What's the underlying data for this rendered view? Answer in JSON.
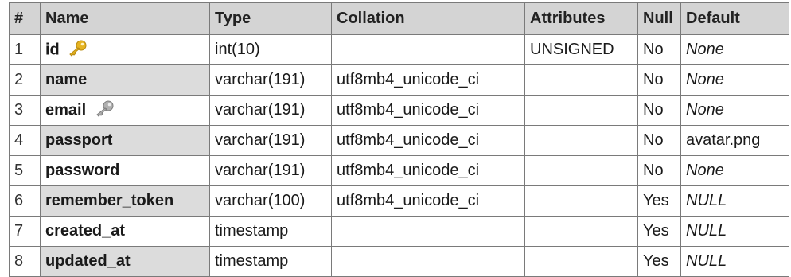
{
  "columns": [
    "#",
    "Name",
    "Type",
    "Collation",
    "Attributes",
    "Null",
    "Default"
  ],
  "rows": [
    {
      "num": "1",
      "name": "id",
      "type": "int(10)",
      "collation": "",
      "attributes": "UNSIGNED",
      "null": "No",
      "default": "None",
      "icon": "primary-key-icon",
      "icon_color": "#e6b422"
    },
    {
      "num": "2",
      "name": "name",
      "type": "varchar(191)",
      "collation": "utf8mb4_unicode_ci",
      "attributes": "",
      "null": "No",
      "default": "None"
    },
    {
      "num": "3",
      "name": "email",
      "type": "varchar(191)",
      "collation": "utf8mb4_unicode_ci",
      "attributes": "",
      "null": "No",
      "default": "None",
      "icon": "unique-key-icon",
      "icon_color": "#9a9a9a"
    },
    {
      "num": "4",
      "name": "passport",
      "type": "varchar(191)",
      "collation": "utf8mb4_unicode_ci",
      "attributes": "",
      "null": "No",
      "default": "avatar.png"
    },
    {
      "num": "5",
      "name": "password",
      "type": "varchar(191)",
      "collation": "utf8mb4_unicode_ci",
      "attributes": "",
      "null": "No",
      "default": "None"
    },
    {
      "num": "6",
      "name": "remember_token",
      "type": "varchar(100)",
      "collation": "utf8mb4_unicode_ci",
      "attributes": "",
      "null": "Yes",
      "default": "NULL"
    },
    {
      "num": "7",
      "name": "created_at",
      "type": "timestamp",
      "collation": "",
      "attributes": "",
      "null": "Yes",
      "default": "NULL"
    },
    {
      "num": "8",
      "name": "updated_at",
      "type": "timestamp",
      "collation": "",
      "attributes": "",
      "null": "Yes",
      "default": "NULL"
    }
  ]
}
